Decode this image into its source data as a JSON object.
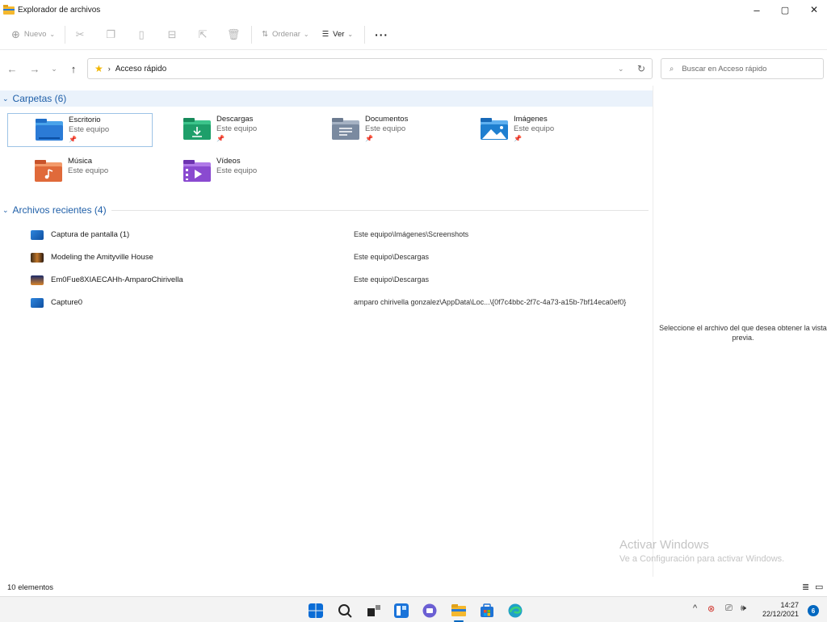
{
  "window": {
    "title": "Explorador de archivos",
    "controls": {
      "minimize": "–",
      "maximize": "▢",
      "close": "✕"
    }
  },
  "toolbar": {
    "new_label": "Nuevo",
    "sort_label": "Ordenar",
    "view_label": "Ver",
    "more_label": "···"
  },
  "address": {
    "path": "Acceso rápido",
    "search_placeholder": "Buscar en Acceso rápido"
  },
  "folders_group": {
    "title": "Carpetas (6)",
    "items": [
      {
        "name": "Escritorio",
        "location": "Este equipo",
        "pinned": true,
        "color": "#2b7bd6"
      },
      {
        "name": "Descargas",
        "location": "Este equipo",
        "pinned": true,
        "color": "#1e9f6a"
      },
      {
        "name": "Documentos",
        "location": "Este equipo",
        "pinned": true,
        "color": "#7a8aa0"
      },
      {
        "name": "Imágenes",
        "location": "Este equipo",
        "pinned": true,
        "color": "#1f7fd0"
      },
      {
        "name": "Música",
        "location": "Este equipo",
        "pinned": false,
        "color": "#e06a3a"
      },
      {
        "name": "Vídeos",
        "location": "Este equipo",
        "pinned": false,
        "color": "#8a4ad0"
      }
    ]
  },
  "recent_group": {
    "title": "Archivos recientes (4)",
    "items": [
      {
        "name": "Captura de pantalla (1)",
        "path": "Este equipo\\Imágenes\\Screenshots"
      },
      {
        "name": "Modeling the Amityville House",
        "path": "Este equipo\\Descargas"
      },
      {
        "name": "Em0Fue8XIAECAHh-AmparoChirivella",
        "path": "Este equipo\\Descargas"
      },
      {
        "name": "Capture0",
        "path": "amparo chirivella gonzalez\\AppData\\Loc...\\{0f7c4bbc-2f7c-4a73-a15b-7bf14eca0ef0}"
      }
    ]
  },
  "preview": {
    "message_line1": "Seleccione el archivo del que desea obtener la vista",
    "message_line2": "previa."
  },
  "watermark": {
    "title": "Activar Windows",
    "subtitle": "Ve a Configuración para activar Windows."
  },
  "status": {
    "count": "10 elementos"
  },
  "taskbar": {
    "time": "14:27",
    "date": "22/12/2021",
    "notifications": "6"
  }
}
